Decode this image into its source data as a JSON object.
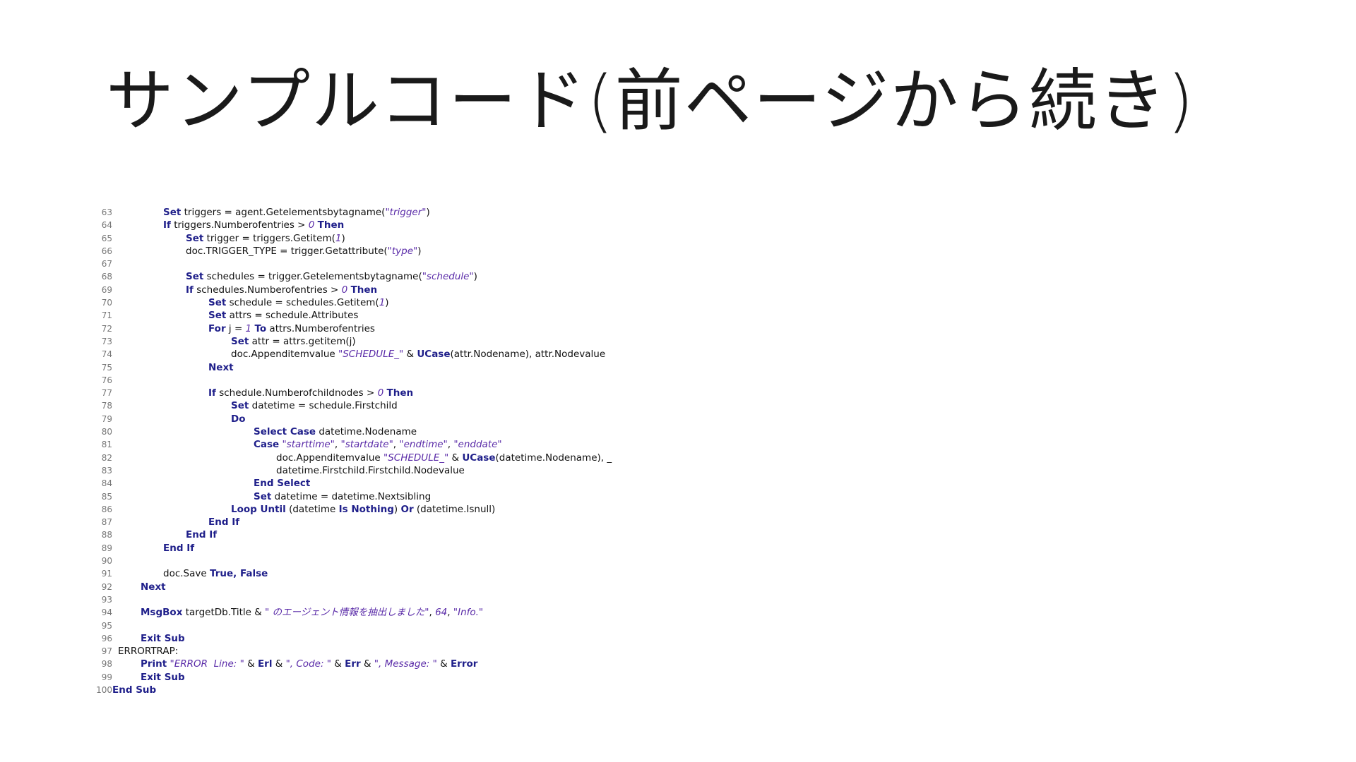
{
  "slide": {
    "title": "サンプルコード(前ページから続き)"
  },
  "code": {
    "lines": [
      {
        "n": "63",
        "indent": 2,
        "parts": [
          [
            "kw",
            "Set"
          ],
          [
            "tx",
            " triggers = agent.Getelementsbytagname("
          ],
          [
            "str",
            "\"trigger\""
          ],
          [
            "tx",
            ")"
          ]
        ]
      },
      {
        "n": "64",
        "indent": 2,
        "parts": [
          [
            "kw",
            "If"
          ],
          [
            "tx",
            " triggers.Numberofentries > "
          ],
          [
            "num",
            "0"
          ],
          [
            "tx",
            " "
          ],
          [
            "kw",
            "Then"
          ]
        ]
      },
      {
        "n": "65",
        "indent": 3,
        "parts": [
          [
            "kw",
            "Set"
          ],
          [
            "tx",
            " trigger = triggers.Getitem("
          ],
          [
            "num",
            "1"
          ],
          [
            "tx",
            ")"
          ]
        ]
      },
      {
        "n": "66",
        "indent": 3,
        "parts": [
          [
            "tx",
            "doc.TRIGGER_TYPE = trigger.Getattribute("
          ],
          [
            "str",
            "\"type\""
          ],
          [
            "tx",
            ")"
          ]
        ]
      },
      {
        "n": "67",
        "indent": 0,
        "parts": []
      },
      {
        "n": "68",
        "indent": 3,
        "parts": [
          [
            "kw",
            "Set"
          ],
          [
            "tx",
            " schedules = trigger.Getelementsbytagname("
          ],
          [
            "str",
            "\"schedule\""
          ],
          [
            "tx",
            ")"
          ]
        ]
      },
      {
        "n": "69",
        "indent": 3,
        "parts": [
          [
            "kw",
            "If"
          ],
          [
            "tx",
            " schedules.Numberofentries > "
          ],
          [
            "num",
            "0"
          ],
          [
            "tx",
            " "
          ],
          [
            "kw",
            "Then"
          ]
        ]
      },
      {
        "n": "70",
        "indent": 4,
        "parts": [
          [
            "kw",
            "Set"
          ],
          [
            "tx",
            " schedule = schedules.Getitem("
          ],
          [
            "num",
            "1"
          ],
          [
            "tx",
            ")"
          ]
        ]
      },
      {
        "n": "71",
        "indent": 4,
        "parts": [
          [
            "kw",
            "Set"
          ],
          [
            "tx",
            " attrs = schedule.Attributes"
          ]
        ]
      },
      {
        "n": "72",
        "indent": 4,
        "parts": [
          [
            "kw",
            "For"
          ],
          [
            "tx",
            " j = "
          ],
          [
            "num",
            "1"
          ],
          [
            "tx",
            " "
          ],
          [
            "kw",
            "To"
          ],
          [
            "tx",
            " attrs.Numberofentries"
          ]
        ]
      },
      {
        "n": "73",
        "indent": 5,
        "parts": [
          [
            "kw",
            "Set"
          ],
          [
            "tx",
            " attr = attrs.getitem(j)"
          ]
        ]
      },
      {
        "n": "74",
        "indent": 5,
        "parts": [
          [
            "tx",
            "doc.Appenditemvalue "
          ],
          [
            "str",
            "\"SCHEDULE_\""
          ],
          [
            "tx",
            " & "
          ],
          [
            "kw",
            "UCase"
          ],
          [
            "tx",
            "(attr.Nodename), attr.Nodevalue"
          ]
        ]
      },
      {
        "n": "75",
        "indent": 4,
        "parts": [
          [
            "kw",
            "Next"
          ]
        ]
      },
      {
        "n": "76",
        "indent": 0,
        "parts": []
      },
      {
        "n": "77",
        "indent": 4,
        "parts": [
          [
            "kw",
            "If"
          ],
          [
            "tx",
            " schedule.Numberofchildnodes > "
          ],
          [
            "num",
            "0"
          ],
          [
            "tx",
            " "
          ],
          [
            "kw",
            "Then"
          ]
        ]
      },
      {
        "n": "78",
        "indent": 5,
        "parts": [
          [
            "kw",
            "Set"
          ],
          [
            "tx",
            " datetime = schedule.Firstchild"
          ]
        ]
      },
      {
        "n": "79",
        "indent": 5,
        "parts": [
          [
            "kw",
            "Do"
          ]
        ]
      },
      {
        "n": "80",
        "indent": 6,
        "parts": [
          [
            "kw",
            "Select Case"
          ],
          [
            "tx",
            " datetime.Nodename"
          ]
        ]
      },
      {
        "n": "81",
        "indent": 6,
        "parts": [
          [
            "kw",
            "Case"
          ],
          [
            "tx",
            " "
          ],
          [
            "str",
            "\"starttime\""
          ],
          [
            "tx",
            ", "
          ],
          [
            "str",
            "\"startdate\""
          ],
          [
            "tx",
            ", "
          ],
          [
            "str",
            "\"endtime\""
          ],
          [
            "tx",
            ", "
          ],
          [
            "str",
            "\"enddate\""
          ]
        ]
      },
      {
        "n": "82",
        "indent": 7,
        "parts": [
          [
            "tx",
            "doc.Appenditemvalue "
          ],
          [
            "str",
            "\"SCHEDULE_\""
          ],
          [
            "tx",
            " & "
          ],
          [
            "kw",
            "UCase"
          ],
          [
            "tx",
            "(datetime.Nodename), _"
          ]
        ]
      },
      {
        "n": "83",
        "indent": 7,
        "parts": [
          [
            "tx",
            "datetime.Firstchild.Firstchild.Nodevalue"
          ]
        ]
      },
      {
        "n": "84",
        "indent": 6,
        "parts": [
          [
            "kw",
            "End Select"
          ]
        ]
      },
      {
        "n": "85",
        "indent": 6,
        "parts": [
          [
            "kw",
            "Set"
          ],
          [
            "tx",
            " datetime = datetime.Nextsibling"
          ]
        ]
      },
      {
        "n": "86",
        "indent": 5,
        "parts": [
          [
            "kw",
            "Loop Until"
          ],
          [
            "tx",
            " (datetime "
          ],
          [
            "kw",
            "Is Nothing"
          ],
          [
            "tx",
            ") "
          ],
          [
            "kw",
            "Or"
          ],
          [
            "tx",
            " (datetime.Isnull)"
          ]
        ]
      },
      {
        "n": "87",
        "indent": 4,
        "parts": [
          [
            "kw",
            "End If"
          ]
        ]
      },
      {
        "n": "88",
        "indent": 3,
        "parts": [
          [
            "kw",
            "End If"
          ]
        ]
      },
      {
        "n": "89",
        "indent": 2,
        "parts": [
          [
            "kw",
            "End If"
          ]
        ]
      },
      {
        "n": "90",
        "indent": 0,
        "parts": []
      },
      {
        "n": "91",
        "indent": 2,
        "parts": [
          [
            "tx",
            "doc.Save "
          ],
          [
            "kw",
            "True, False"
          ]
        ]
      },
      {
        "n": "92",
        "indent": 1,
        "parts": [
          [
            "kw",
            "Next"
          ]
        ]
      },
      {
        "n": "93",
        "indent": 0,
        "parts": []
      },
      {
        "n": "94",
        "indent": 1,
        "parts": [
          [
            "kw",
            "MsgBox"
          ],
          [
            "tx",
            " targetDb.Title & "
          ],
          [
            "str",
            "\" のエージェント情報を抽出しました\""
          ],
          [
            "tx",
            ", "
          ],
          [
            "num",
            "64"
          ],
          [
            "tx",
            ", "
          ],
          [
            "str",
            "\"Info.\""
          ]
        ]
      },
      {
        "n": "95",
        "indent": 0,
        "parts": []
      },
      {
        "n": "96",
        "indent": 1,
        "parts": [
          [
            "kw",
            "Exit Sub"
          ]
        ]
      },
      {
        "n": "97",
        "indent": 0,
        "parts": [
          [
            "tx",
            "ERRORTRAP:"
          ]
        ]
      },
      {
        "n": "98",
        "indent": 1,
        "parts": [
          [
            "kw",
            "Print"
          ],
          [
            "tx",
            " "
          ],
          [
            "str",
            "\"ERROR  Line: \""
          ],
          [
            "tx",
            " & "
          ],
          [
            "kw",
            "Erl"
          ],
          [
            "tx",
            " & "
          ],
          [
            "str",
            "\", Code: \""
          ],
          [
            "tx",
            " & "
          ],
          [
            "kw",
            "Err"
          ],
          [
            "tx",
            " & "
          ],
          [
            "str",
            "\", Message: \""
          ],
          [
            "tx",
            " & "
          ],
          [
            "kw",
            "Error"
          ]
        ]
      },
      {
        "n": "99",
        "indent": 1,
        "parts": [
          [
            "kw",
            "Exit Sub"
          ]
        ]
      },
      {
        "n": "100",
        "indent": 0,
        "parts": [
          [
            "kw",
            "End Sub"
          ]
        ]
      }
    ]
  }
}
